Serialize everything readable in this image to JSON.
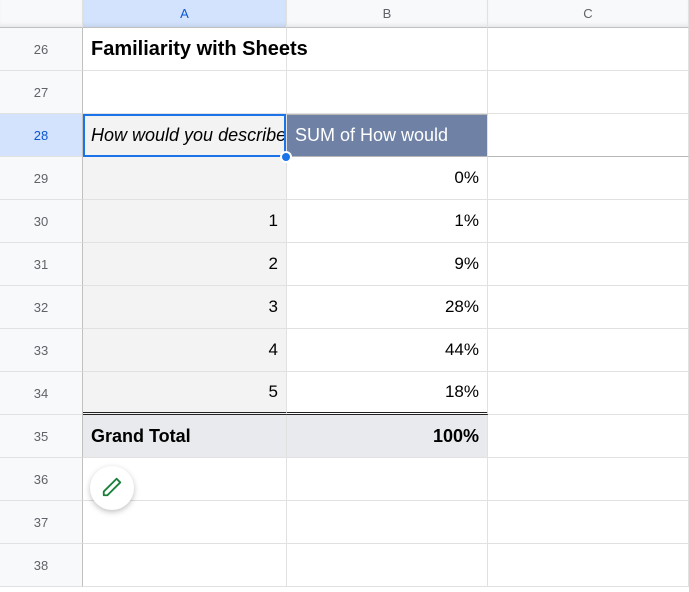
{
  "columns": {
    "a": "A",
    "b": "B",
    "c": "C"
  },
  "selected_column": "A",
  "selected_row": "28",
  "rows": {
    "r26": "26",
    "r27": "27",
    "r28": "28",
    "r29": "29",
    "r30": "30",
    "r31": "31",
    "r32": "32",
    "r33": "33",
    "r34": "34",
    "r35": "35",
    "r36": "36",
    "r37": "37",
    "r38": "38"
  },
  "cells": {
    "a26": "Familiarity with Sheets",
    "a28": "How would you describe",
    "b28": "SUM of How would",
    "b29": "0%",
    "a30": "1",
    "b30": "1%",
    "a31": "2",
    "b31": "9%",
    "a32": "3",
    "b32": "28%",
    "a33": "4",
    "b33": "44%",
    "a34": "5",
    "b34": "18%",
    "a35": "Grand Total",
    "b35": "100%"
  },
  "chart_data": {
    "type": "table",
    "title": "Familiarity with Sheets",
    "row_field": "How would you describe",
    "value_field": "SUM of How would",
    "categories": [
      "",
      "1",
      "2",
      "3",
      "4",
      "5"
    ],
    "values_pct": [
      0,
      1,
      9,
      28,
      44,
      18
    ],
    "grand_total_pct": 100
  }
}
